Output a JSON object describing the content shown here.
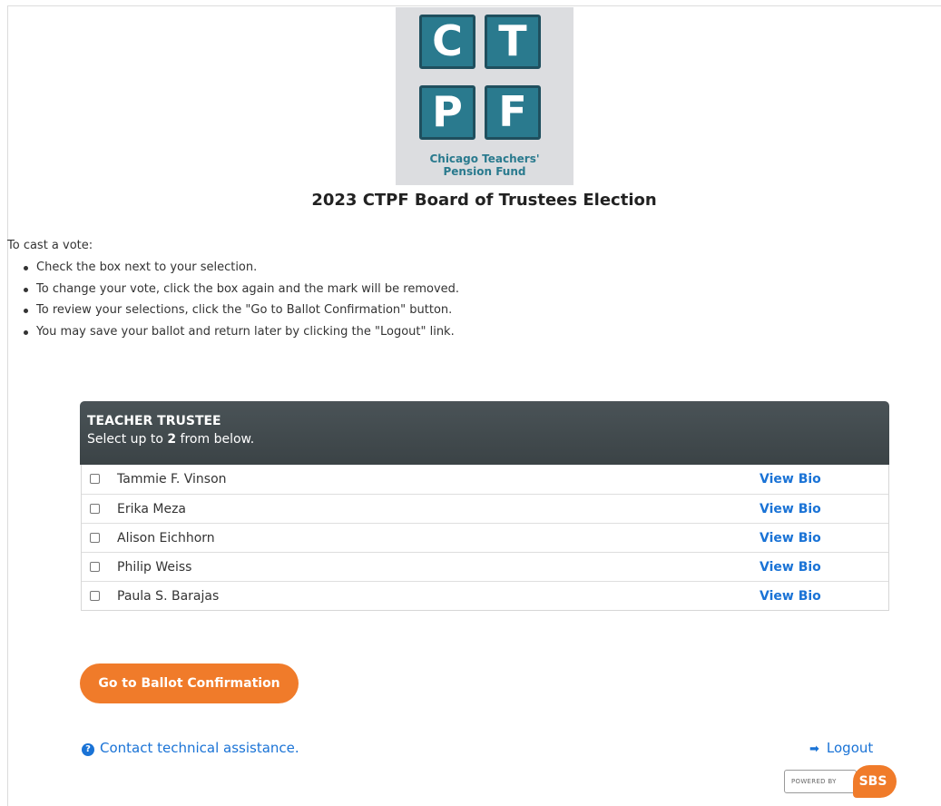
{
  "logo": {
    "letters": [
      "C",
      "T",
      "P",
      "F"
    ],
    "line1": "Chicago Teachers'",
    "line2": "Pension Fund",
    "tile_color": "#2a7a8e"
  },
  "page_title": "2023 CTPF Board of Trustees Election",
  "instructions": {
    "intro": "To cast a vote:",
    "items": [
      "Check the box next to your selection.",
      "To change your vote, click the box again and the mark will be removed.",
      "To review your selections, click the \"Go to Ballot Confirmation\" button.",
      "You may save your ballot and return later by clicking the \"Logout\" link."
    ]
  },
  "ballot": {
    "title": "TEACHER TRUSTEE",
    "select_prefix": "Select up to ",
    "select_count": "2",
    "select_suffix": " from below.",
    "candidates": [
      {
        "name": "Tammie F. Vinson",
        "bio_label": "View Bio",
        "checked": false
      },
      {
        "name": "Erika Meza",
        "bio_label": "View Bio",
        "checked": false
      },
      {
        "name": "Alison Eichhorn",
        "bio_label": "View Bio",
        "checked": false
      },
      {
        "name": "Philip Weiss",
        "bio_label": "View Bio",
        "checked": false
      },
      {
        "name": "Paula S. Barajas",
        "bio_label": "View Bio",
        "checked": false
      }
    ]
  },
  "confirm_button": "Go to Ballot Confirmation",
  "help_link": "Contact technical assistance.",
  "logout_link": "Logout",
  "powered_by": {
    "prefix": "POWERED BY",
    "brand": "SBS"
  },
  "colors": {
    "accent_orange": "#f07b2a",
    "link_blue": "#1a73d6",
    "header_gray": "#444c50"
  },
  "icons": {
    "help": "question-circle-icon",
    "logout": "sign-out-icon"
  }
}
